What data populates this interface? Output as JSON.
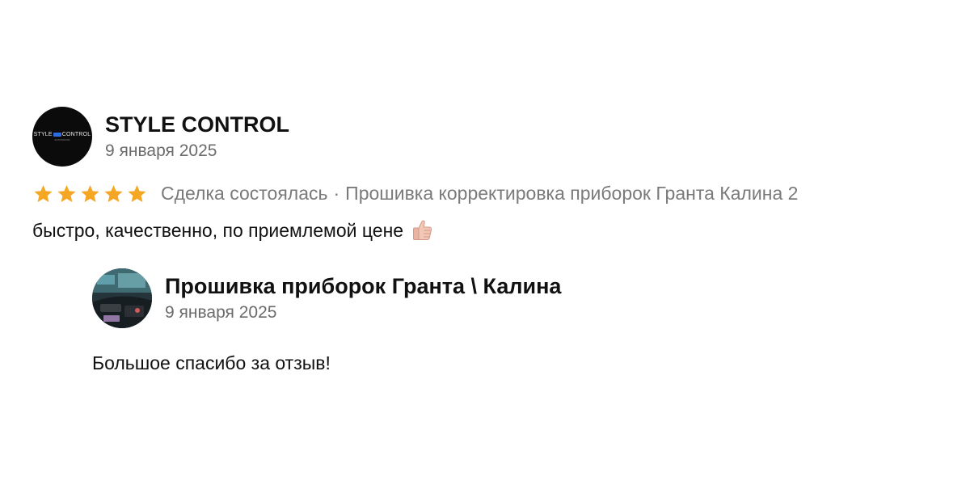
{
  "review": {
    "author": "STYLE CONTROL",
    "date": "9 января 2025",
    "rating": 5,
    "rating_max": 5,
    "star_color": "#f5a623",
    "deal_status": "Сделка состоялась",
    "separator": "·",
    "item_title": "Прошивка корректировка приборок Гранта Калина 2",
    "text": "быстро, качественно, по приемлемой цене",
    "emoji_icon": "thumbs-up-icon",
    "avatar_logo": {
      "left": "STYLE",
      "right": "CONTROL",
      "sub": "AUTOSOUND"
    }
  },
  "reply": {
    "author": "Прошивка приборок Гранта \\ Калина",
    "date": "9 января 2025",
    "text": "Большое спасибо за отзыв!"
  }
}
